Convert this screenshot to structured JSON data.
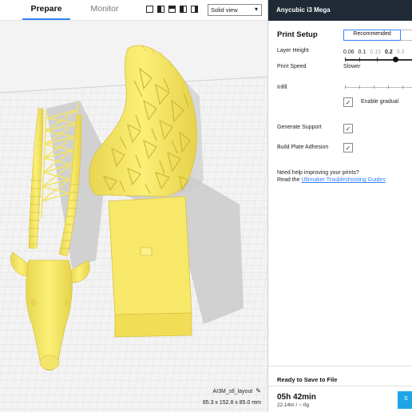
{
  "topbar": {
    "tabs": [
      {
        "label": "Prepare",
        "active": true
      },
      {
        "label": "Monitor",
        "active": false
      }
    ],
    "view_buttons": [
      "view-3d-icon",
      "view-front-icon",
      "view-top-icon",
      "view-left-icon",
      "view-right-icon"
    ],
    "view_mode": "Solid view"
  },
  "viewport": {
    "model_name": "AI3M_stl_layout",
    "model_dimensions": "85.3 x 152.8 x 85.0 mm",
    "model_color": "#f9ec6f",
    "shadow_color": "#cdcdcd"
  },
  "panel": {
    "printer_name": "Anycubic i3 Mega",
    "setup_title": "Print Setup",
    "recommended_label": "Recommended",
    "layer_height_label": "Layer Height",
    "layer_height_values": [
      "0.06",
      "0.1",
      "0.15",
      "0.2",
      "0.3"
    ],
    "layer_height_selected": "0.2",
    "print_speed_label": "Print Speed",
    "print_speed_value": "Slower",
    "infill_label": "Infill",
    "enable_gradual_label": "Enable gradual",
    "enable_gradual_checked": true,
    "generate_support_label": "Generate Support",
    "generate_support_checked": true,
    "build_plate_adhesion_label": "Build Plate Adhesion",
    "build_plate_adhesion_checked": true,
    "help_line1": "Need help improving your prints?",
    "help_line2_prefix": "Read the",
    "help_link": "Ultimaker Troubleshooting Guides",
    "ready_label": "Ready to Save to File",
    "print_time": "05h 42min",
    "print_amount": "22.14m / ~ 0g",
    "save_label": "S",
    "accent_color": "#3282ff",
    "header_color": "#1f2a36",
    "save_color": "#1ea5e6"
  }
}
